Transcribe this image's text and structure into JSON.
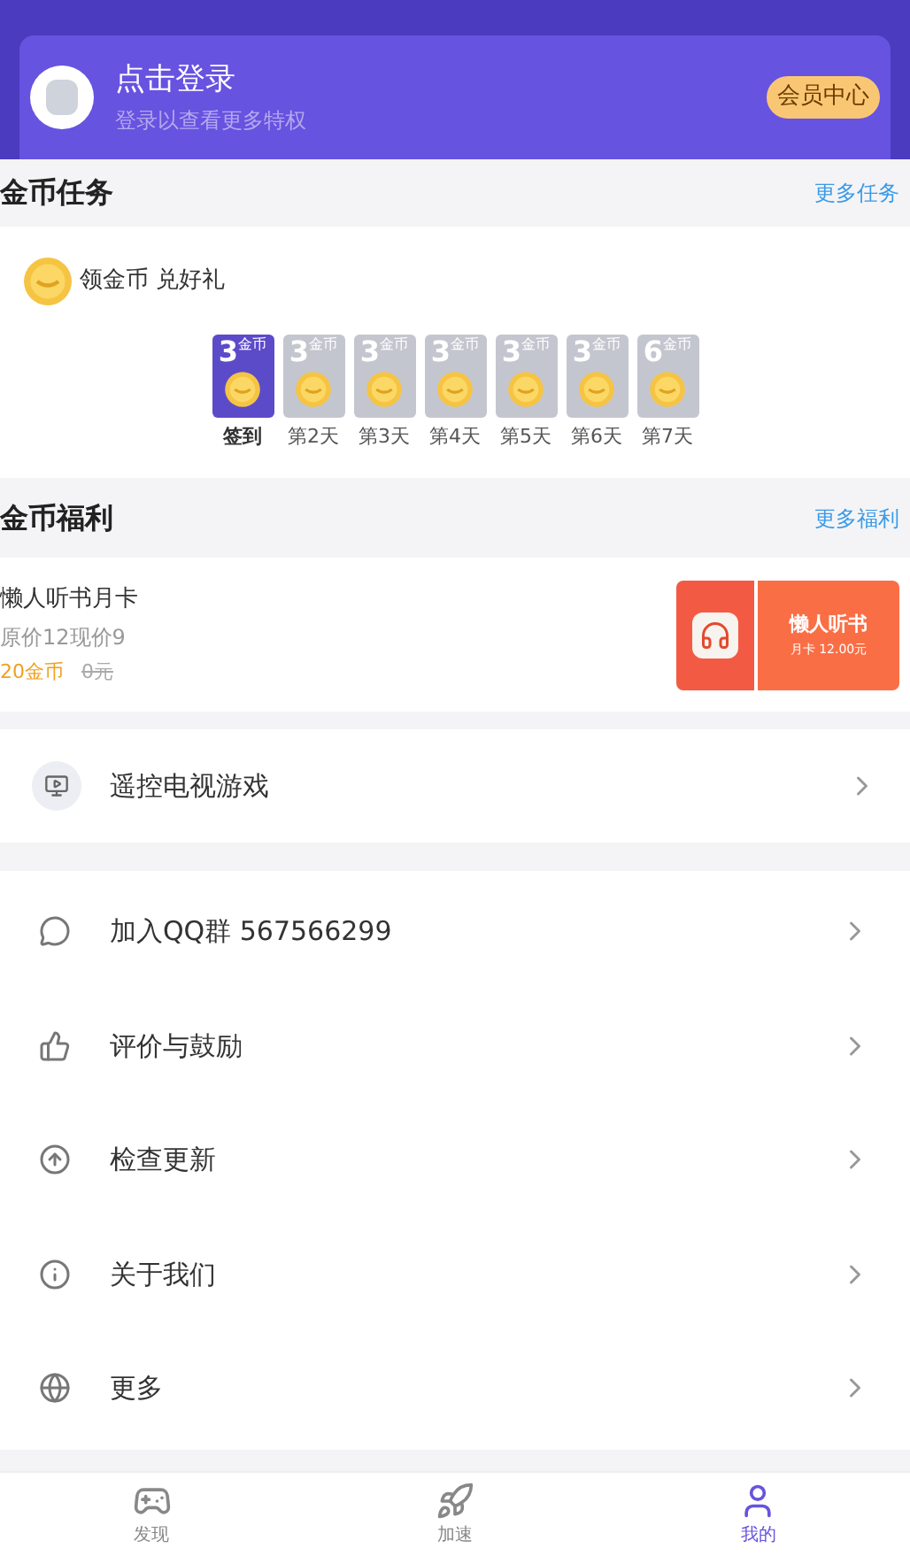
{
  "header": {
    "title": "点击登录",
    "subtitle": "登录以查看更多特权",
    "member_button": "会员中心"
  },
  "coin_tasks": {
    "title": "金币任务",
    "more": "更多任务",
    "slogan": "领金币 兑好礼",
    "days": [
      {
        "amount": "3",
        "unit": "金币",
        "label": "签到",
        "selected": true
      },
      {
        "amount": "3",
        "unit": "金币",
        "label": "第2天",
        "selected": false
      },
      {
        "amount": "3",
        "unit": "金币",
        "label": "第3天",
        "selected": false
      },
      {
        "amount": "3",
        "unit": "金币",
        "label": "第4天",
        "selected": false
      },
      {
        "amount": "3",
        "unit": "金币",
        "label": "第5天",
        "selected": false
      },
      {
        "amount": "3",
        "unit": "金币",
        "label": "第6天",
        "selected": false
      },
      {
        "amount": "6",
        "unit": "金币",
        "label": "第7天",
        "selected": false
      }
    ]
  },
  "coin_welfare": {
    "title": "金币福利",
    "more": "更多福利",
    "item": {
      "name": "懒人听书月卡",
      "price_note": "原价12现价9",
      "coins": "20金币",
      "old_price": "0元",
      "card_title": "懒人听书",
      "card_subtitle": "月卡 12.00元"
    }
  },
  "remote": {
    "label": "遥控电视游戏"
  },
  "menu": [
    {
      "label": "加入QQ群 567566299"
    },
    {
      "label": "评价与鼓励"
    },
    {
      "label": "检查更新"
    },
    {
      "label": "关于我们"
    },
    {
      "label": "更多"
    }
  ],
  "tabs": [
    {
      "label": "发现",
      "selected": false
    },
    {
      "label": "加速",
      "selected": false
    },
    {
      "label": "我的",
      "selected": true
    }
  ]
}
